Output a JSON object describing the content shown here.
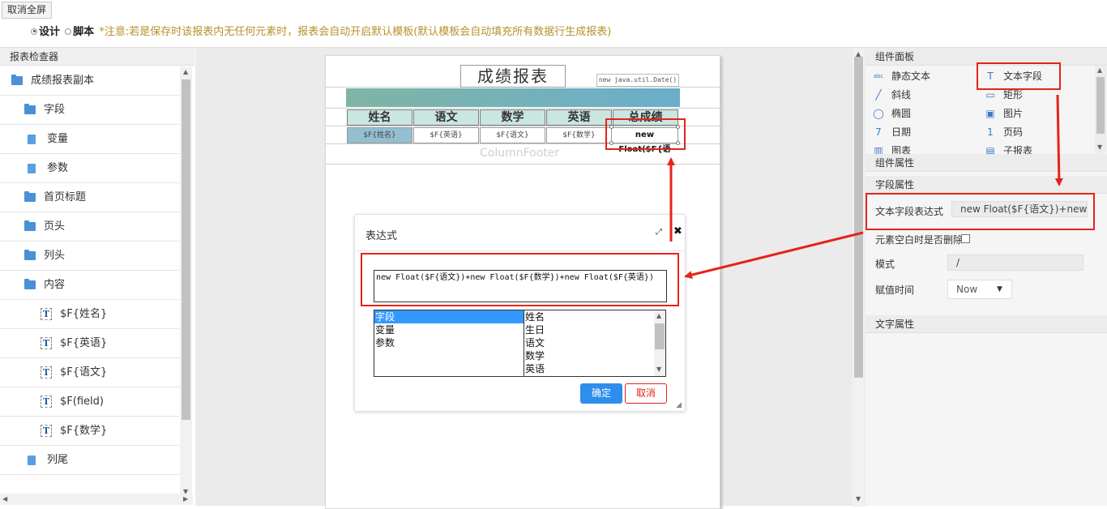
{
  "toolbar": {
    "exit_fullscreen": "取消全屏"
  },
  "mode": {
    "design": "设计",
    "script": "脚本",
    "notice": "*注意:若是保存时该报表内无任何元素时，报表会自动开启默认模板(默认模板会自动填充所有数据行生成报表)"
  },
  "inspector": {
    "title": "报表检查器",
    "items": [
      {
        "label": "成绩报表副本",
        "icon": "folder-open-icon"
      },
      {
        "label": "字段",
        "icon": "folder-icon"
      },
      {
        "label": "变量",
        "icon": "document-icon"
      },
      {
        "label": "参数",
        "icon": "document-icon"
      },
      {
        "label": "首页标题",
        "icon": "folder-icon"
      },
      {
        "label": "页头",
        "icon": "folder-icon"
      },
      {
        "label": "列头",
        "icon": "folder-icon"
      },
      {
        "label": "内容",
        "icon": "folder-open-icon"
      },
      {
        "label": "$F{姓名}",
        "icon": "text-field-icon"
      },
      {
        "label": "$F{英语}",
        "icon": "text-field-icon"
      },
      {
        "label": "$F{语文}",
        "icon": "text-field-icon"
      },
      {
        "label": "$F(field)",
        "icon": "text-field-icon"
      },
      {
        "label": "$F{数学}",
        "icon": "text-field-icon"
      },
      {
        "label": "列尾",
        "icon": "document-icon"
      }
    ]
  },
  "canvas": {
    "title": "成绩报表",
    "date_expr": "new java.util.Date()",
    "headers": [
      "姓名",
      "语文",
      "数学",
      "英语",
      "总成绩"
    ],
    "cells": [
      "$F{姓名}",
      "$F{英语}",
      "$F{语文}",
      "$F{数学}",
      "new Float($F{语"
    ],
    "column_footer": "ColumnFooter"
  },
  "dialog": {
    "title": "表达式",
    "expression": "new Float($F{语文})+new Float($F{数学})+new Float($F{英语})",
    "categories": [
      "字段",
      "变量",
      "参数"
    ],
    "fields": [
      "姓名",
      "生日",
      "语文",
      "数学",
      "英语"
    ],
    "ok": "确定",
    "cancel": "取消"
  },
  "components": {
    "title": "组件面板",
    "items": [
      {
        "label": "静态文本",
        "icon": "static-text-icon"
      },
      {
        "label": "文本字段",
        "icon": "text-field-icon"
      },
      {
        "label": "斜线",
        "icon": "diagonal-line-icon"
      },
      {
        "label": "矩形",
        "icon": "rectangle-icon"
      },
      {
        "label": "椭圆",
        "icon": "ellipse-icon"
      },
      {
        "label": "图片",
        "icon": "image-icon"
      },
      {
        "label": "日期",
        "icon": "calendar-icon"
      },
      {
        "label": "页码",
        "icon": "page-number-icon"
      },
      {
        "label": "图表",
        "icon": "chart-icon"
      },
      {
        "label": "子报表",
        "icon": "subreport-icon"
      }
    ]
  },
  "properties": {
    "component_props": "组件属性",
    "field_props": "字段属性",
    "expr_label": "文本字段表达式",
    "expr_value": "new Float($F{语文})+new F",
    "blank_delete_label": "元素空白时是否删除",
    "mode_label": "模式",
    "mode_value": "/",
    "assign_time_label": "赋值时间",
    "assign_time_value": "Now",
    "text_props": "文字属性"
  },
  "colors": {
    "highlight": "#e5231b",
    "primary": "#2e8ded",
    "header_bg": "#c9e6e0"
  }
}
